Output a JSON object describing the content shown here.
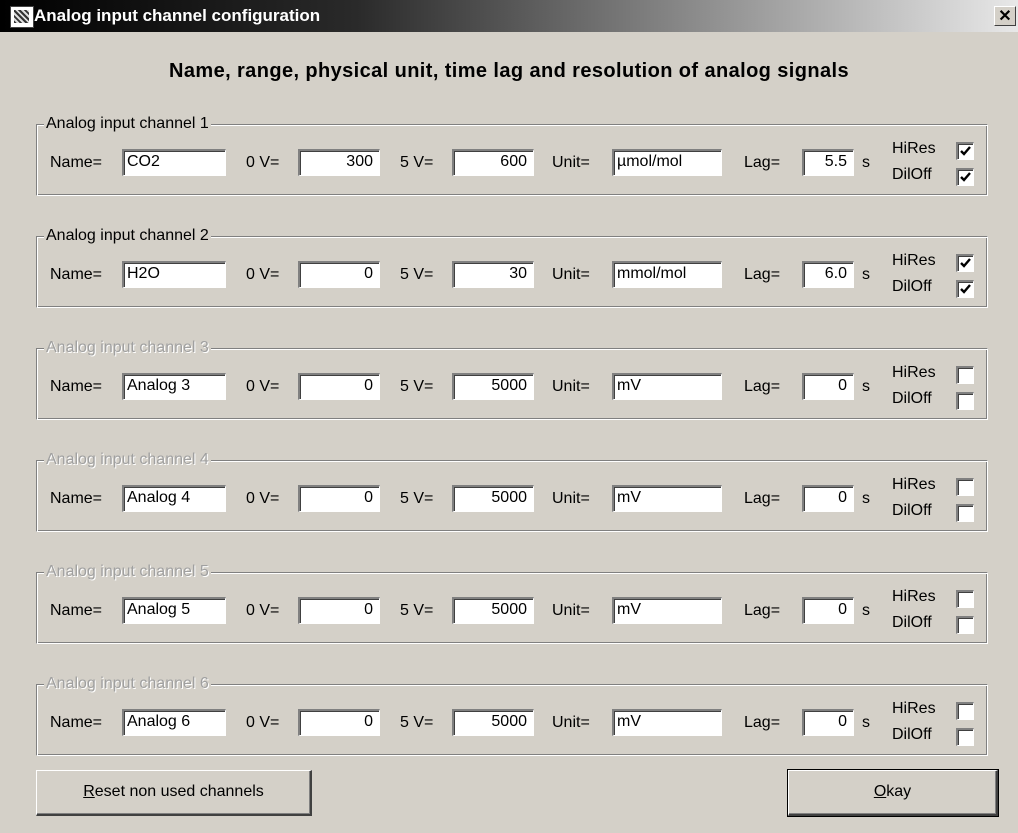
{
  "window": {
    "title": "Analog input channel configuration",
    "close_glyph": "✕",
    "app_icon": "app-icon"
  },
  "heading": "Name, range, physical unit, time lag and resolution of analog signals",
  "labels": {
    "name": "Name=",
    "zero_v": "0 V=",
    "five_v": "5 V=",
    "unit": "Unit=",
    "lag": "Lag=",
    "seconds": "s",
    "hires": "HiRes",
    "diloff": "DilOff"
  },
  "channels": [
    {
      "title": "Analog input channel 1",
      "enabled": true,
      "name": "CO2",
      "v0": "300",
      "v5": "600",
      "unit": "µmol/mol",
      "lag": "5.5",
      "hires": true,
      "diloff": true
    },
    {
      "title": "Analog input channel 2",
      "enabled": true,
      "name": "H2O",
      "v0": "0",
      "v5": "30",
      "unit": "mmol/mol",
      "lag": "6.0",
      "hires": true,
      "diloff": true
    },
    {
      "title": "Analog input channel 3",
      "enabled": false,
      "name": "Analog 3",
      "v0": "0",
      "v5": "5000",
      "unit": "mV",
      "lag": "0",
      "hires": false,
      "diloff": false
    },
    {
      "title": "Analog input channel 4",
      "enabled": false,
      "name": "Analog 4",
      "v0": "0",
      "v5": "5000",
      "unit": "mV",
      "lag": "0",
      "hires": false,
      "diloff": false
    },
    {
      "title": "Analog input channel 5",
      "enabled": false,
      "name": "Analog 5",
      "v0": "0",
      "v5": "5000",
      "unit": "mV",
      "lag": "0",
      "hires": false,
      "diloff": false
    },
    {
      "title": "Analog input channel 6",
      "enabled": false,
      "name": "Analog 6",
      "v0": "0",
      "v5": "5000",
      "unit": "mV",
      "lag": "0",
      "hires": false,
      "diloff": false
    }
  ],
  "buttons": {
    "reset": {
      "mnemonic": "R",
      "rest": "eset non used channels"
    },
    "okay": {
      "mnemonic": "O",
      "rest": "kay"
    }
  }
}
